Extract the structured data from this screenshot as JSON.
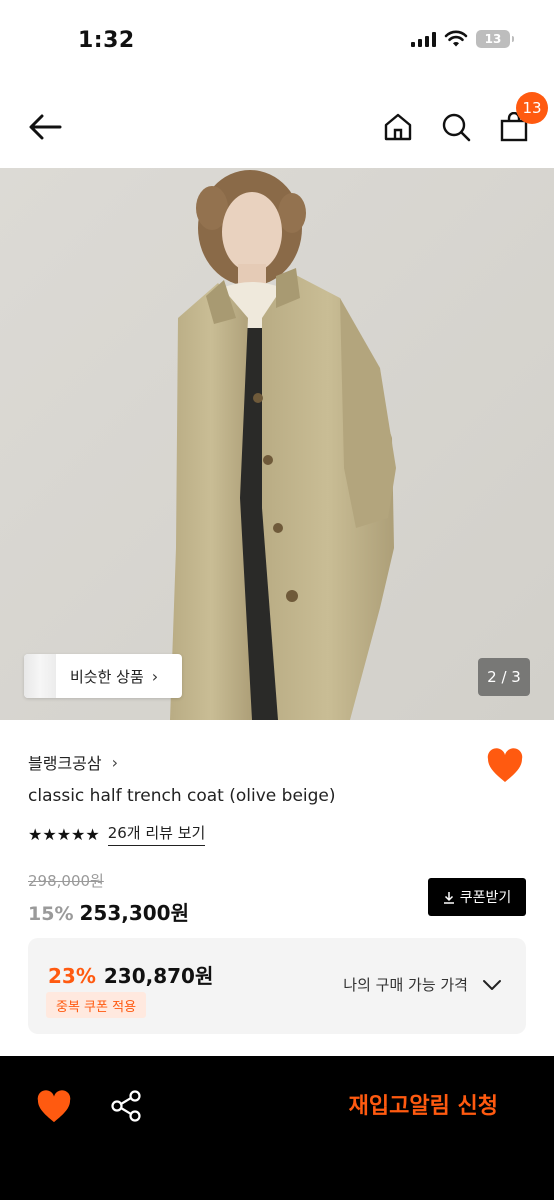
{
  "status_bar": {
    "time": "1:32",
    "battery": "13"
  },
  "nav": {
    "cart_count": "13"
  },
  "gallery": {
    "similar_label": "비슷한 상품",
    "page_counter": "2 / 3"
  },
  "product": {
    "brand": "블랭크공삼",
    "name": "classic half trench coat (olive beige)",
    "rating_stars": 5,
    "review_link": "26개 리뷰 보기",
    "original_price": "298,000원",
    "discount_rate": "15%",
    "sale_price": "253,300원",
    "coupon_button": "쿠폰받기"
  },
  "best_price": {
    "rate": "23%",
    "price": "230,870원",
    "coupon_tag": "중복 쿠폰 적용",
    "my_price_label": "나의 구매 가능 가격"
  },
  "bottom_bar": {
    "restock_label": "재입고알림 신청"
  },
  "colors": {
    "accent": "#ff5a10",
    "black": "#000000",
    "muted": "#9a9a9a"
  }
}
